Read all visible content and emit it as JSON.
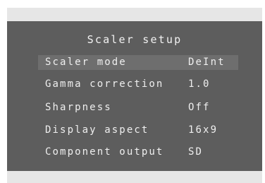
{
  "menu": {
    "title": "Scaler setup",
    "items": [
      {
        "label": "Scaler mode",
        "value": "DeInt",
        "selected": true
      },
      {
        "label": "Gamma correction",
        "value": "1.0",
        "selected": false
      },
      {
        "label": "Sharpness",
        "value": "Off",
        "selected": false
      },
      {
        "label": "Display aspect",
        "value": "16x9",
        "selected": false
      },
      {
        "label": "Component output",
        "value": "SD",
        "selected": false
      }
    ]
  },
  "colors": {
    "panel_background": "#5d5d5d",
    "selection_highlight": "#6e6e6e",
    "text": "#efefef",
    "bezel": "#e6e6e6"
  }
}
